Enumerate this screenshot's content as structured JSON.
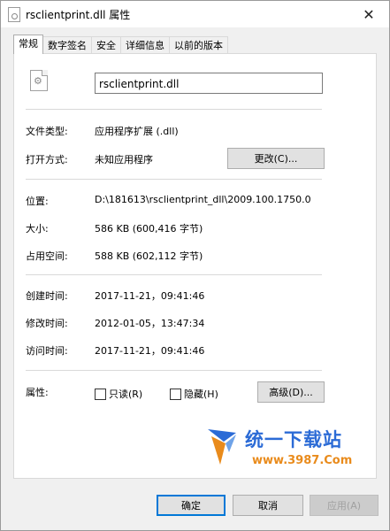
{
  "window": {
    "title": "rsclientprint.dll 属性",
    "close_glyph": "✕"
  },
  "tabs": [
    {
      "label": "常规",
      "active": true
    },
    {
      "label": "数字签名",
      "active": false
    },
    {
      "label": "安全",
      "active": false
    },
    {
      "label": "详细信息",
      "active": false
    },
    {
      "label": "以前的版本",
      "active": false
    }
  ],
  "general": {
    "file_name": "rsclientprint.dll",
    "file_type_label": "文件类型:",
    "file_type_value": "应用程序扩展 (.dll)",
    "opens_with_label": "打开方式:",
    "opens_with_value": "未知应用程序",
    "change_button": "更改(C)...",
    "location_label": "位置:",
    "location_value": "D:\\181613\\rsclientprint_dll\\2009.100.1750.0",
    "size_label": "大小:",
    "size_value": "586 KB (600,416 字节)",
    "size_on_disk_label": "占用空间:",
    "size_on_disk_value": "588 KB (602,112 字节)",
    "created_label": "创建时间:",
    "created_value": "2017-11-21，09:41:46",
    "modified_label": "修改时间:",
    "modified_value": "2012-01-05，13:47:34",
    "accessed_label": "访问时间:",
    "accessed_value": "2017-11-21，09:41:46",
    "attributes_label": "属性:",
    "readonly_label": "只读(R)",
    "hidden_label": "隐藏(H)",
    "advanced_button": "高级(D)..."
  },
  "watermark": {
    "title": "统一下载站",
    "url": "www.3987.Com"
  },
  "footer": {
    "ok_button": "确定",
    "cancel_button": "取消",
    "apply_button": "应用(A)"
  },
  "colors": {
    "accent": "#0078d7",
    "watermark_blue": "#2b6bd6",
    "watermark_orange": "#e98b1c"
  }
}
